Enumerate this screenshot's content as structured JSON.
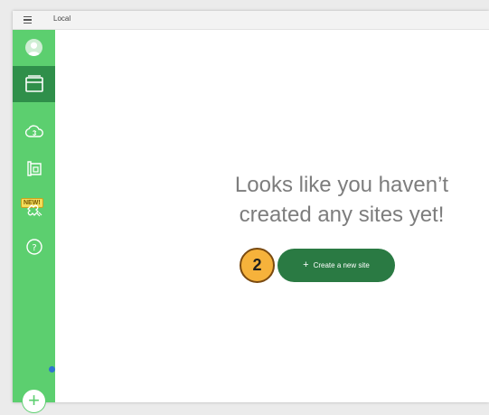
{
  "window": {
    "title": "Local"
  },
  "sidebar": {
    "items": [
      {
        "name": "avatar"
      },
      {
        "name": "sites",
        "icon": "sites-icon",
        "active": true
      },
      {
        "name": "connect",
        "icon": "cloud-icon"
      },
      {
        "name": "blueprints",
        "icon": "blueprint-icon",
        "badge": "NEW!"
      },
      {
        "name": "add-ons",
        "icon": "puzzle-icon"
      },
      {
        "name": "help",
        "icon": "help-icon"
      }
    ],
    "add_label": "+"
  },
  "main": {
    "empty_title_line1": "Looks like you haven’t",
    "empty_title_line2": "created any sites yet!",
    "create_button_icon": "+",
    "create_button_label": "Create a new site"
  },
  "callout": {
    "number": "2"
  },
  "colors": {
    "sidebar": "#5ccf6f",
    "sidebar_active": "#2f8f4a",
    "button": "#2a7a43",
    "callout": "#f6b23b"
  }
}
